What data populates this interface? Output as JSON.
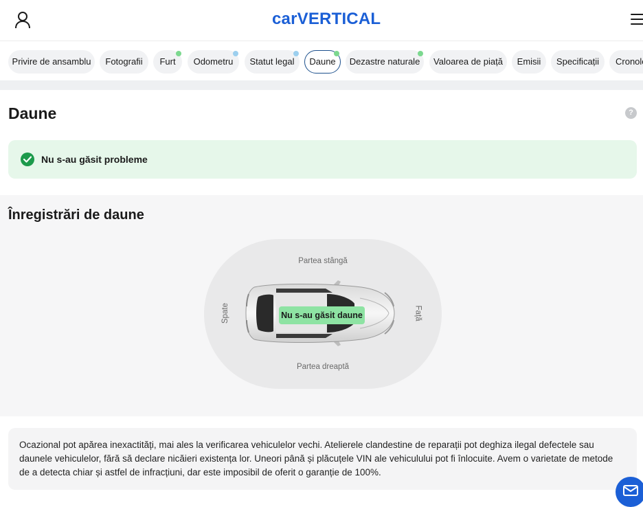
{
  "header": {
    "logo": "carVERTICAL"
  },
  "tabs": [
    {
      "label": "Privire de ansamblu",
      "active": false,
      "dot": null
    },
    {
      "label": "Fotografii",
      "active": false,
      "dot": null
    },
    {
      "label": "Furt",
      "active": false,
      "dot": "#7cd88f"
    },
    {
      "label": "Odometru",
      "active": false,
      "dot": "#9ccfee"
    },
    {
      "label": "Statut legal",
      "active": false,
      "dot": "#9ccfee"
    },
    {
      "label": "Daune",
      "active": true,
      "dot": "#7cd88f"
    },
    {
      "label": "Dezastre naturale",
      "active": false,
      "dot": "#7cd88f"
    },
    {
      "label": "Valoarea de piață",
      "active": false,
      "dot": null
    },
    {
      "label": "Emisii",
      "active": false,
      "dot": null
    },
    {
      "label": "Specificații",
      "active": false,
      "dot": null
    },
    {
      "label": "Cronologie",
      "active": false,
      "dot": null
    }
  ],
  "section": {
    "title": "Daune",
    "help": "?",
    "status": "Nu s-au găsit probleme",
    "status_color": "#1c9a4b"
  },
  "records": {
    "title": "Înregistrări de daune",
    "left_side": "Partea stângă",
    "right_side": "Partea dreaptă",
    "rear": "Spate",
    "front": "Față",
    "badge": "Nu s-au găsit daune",
    "badge_color": "#8ee3a3"
  },
  "disclaimer": "Ocazional pot apărea inexactități, mai ales la verificarea vehiculelor vechi. Atelierele clandestine de reparații pot deghiza ilegal defectele sau daunele vehiculelor, fără să declare nicăieri existența lor. Uneori până și plăcuțele VIN ale vehiculului pot fi înlocuite. Avem o varietate de metode de a detecta chiar și astfel de infracțiuni, dar este imposibil de oferit o garanție de 100%.",
  "icons": {
    "user": "user-icon",
    "menu": "hamburger-menu-icon",
    "chat": "mail-icon"
  }
}
